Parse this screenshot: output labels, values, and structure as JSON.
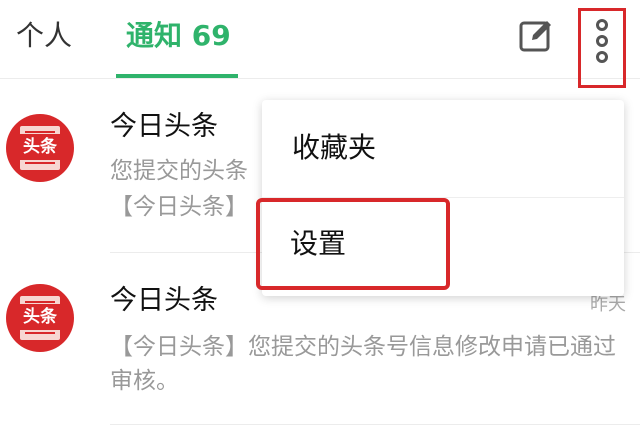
{
  "header": {
    "tab_personal": "个人",
    "tab_notify": "通知 69",
    "compose_icon": "edit-square-icon",
    "more_icon": "more-vertical-icon"
  },
  "menu": {
    "items": [
      {
        "label": "收藏夹"
      },
      {
        "label": "设置"
      }
    ]
  },
  "notifications": [
    {
      "app": "今日头条",
      "avatar_text": "头条",
      "body": "您提交的头条…【今日头条】…",
      "body_line1": "您提交的头条",
      "body_line2": "【今日头条】",
      "time": ""
    },
    {
      "app": "今日头条",
      "avatar_text": "头条",
      "body": "【今日头条】您提交的头条号信息修改申请已通过审核。",
      "time": "昨天"
    }
  ],
  "colors": {
    "accent": "#2fb36b",
    "highlight": "#d8282a",
    "avatar_bg": "#d8282a"
  }
}
